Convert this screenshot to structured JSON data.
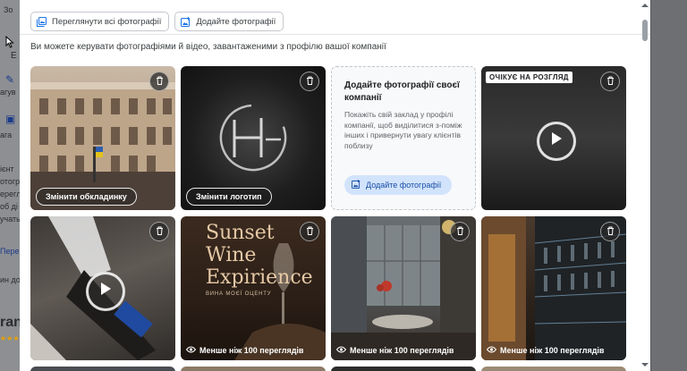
{
  "background": {
    "left_texts": [
      "Зо",
      "Е",
      "агув",
      "ага",
      "ієнт",
      "отогр",
      "ерегля",
      "об ді",
      "учать",
      "Перегл",
      "ин дос",
      "ran"
    ]
  },
  "toolbar": {
    "view_all_label": "Переглянути всі фотографії",
    "add_photos_label": "Додайте фотографії"
  },
  "description": "Ви можете керувати фотографіями й відео, завантаженими з профілю вашої компанії",
  "tiles": {
    "cover": {
      "button_label": "Змінити обкладинку"
    },
    "logo": {
      "button_label": "Змінити логотип",
      "logo_letter": "HG"
    },
    "add_card": {
      "title": "Додайте фотографії своєї компанії",
      "body": "Покажіть свій заклад у профілі компанії, щоб виділитися з-поміж інших і привернути увагу клієнтів поблизу",
      "button_label": "Додайте фотографії"
    },
    "pending_video": {
      "badge": "ОЧІКУЄ НА РОЗГЛЯД"
    },
    "wine": {
      "line1": "Sunset",
      "line2": "Wine",
      "line3": "Expirience",
      "subtitle": "ВИНА МОЄЇ ОЦЕНТУ",
      "views": "Менше ніж 100 переглядів"
    },
    "interior": {
      "views": "Менше ніж 100 переглядів"
    },
    "bar": {
      "views": "Менше ніж 100 переглядів"
    }
  },
  "colors": {
    "accent_button_bg": "#d2e3fc",
    "accent_button_text": "#174ea6",
    "badge_bg": "#ffffff"
  },
  "icons": {
    "view_all": "photo-library-icon",
    "add_photo": "add-photo-icon",
    "delete": "trash-icon",
    "play": "play-icon",
    "views": "eye-icon"
  }
}
